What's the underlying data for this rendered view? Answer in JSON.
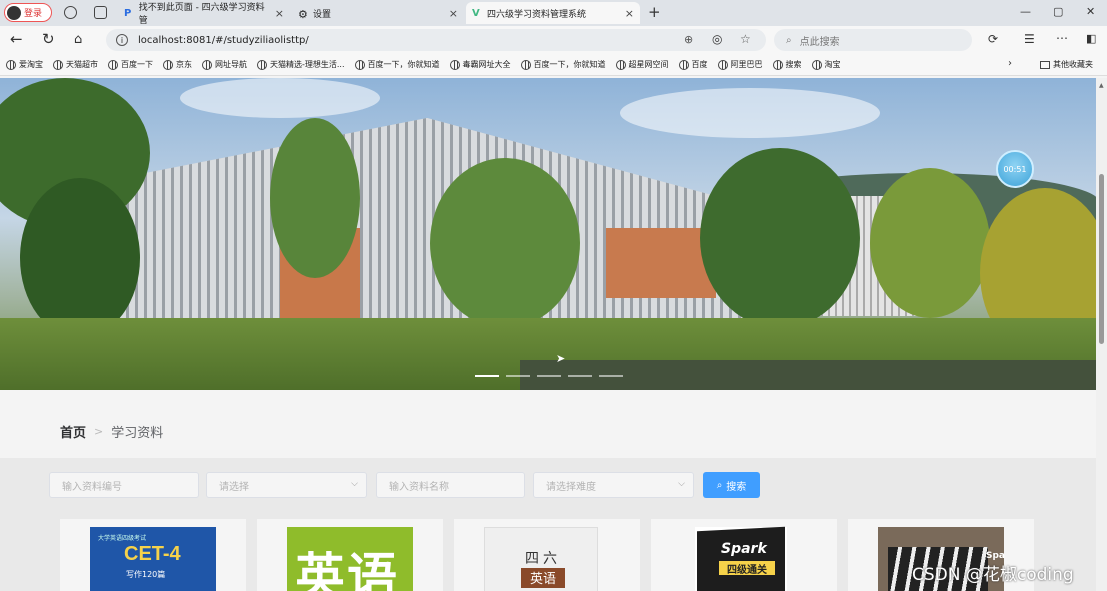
{
  "browser": {
    "profile_label": "登录",
    "tabs": [
      {
        "label": "找不到此页面 - 四六级学习资料管",
        "close": "×"
      },
      {
        "label": "设置",
        "close": "×"
      },
      {
        "label": "四六级学习资料管理系统",
        "close": "×"
      }
    ],
    "new_tab": "+",
    "url": "localhost:8081/#/studyziliaolisttp/",
    "search_placeholder": "点此搜索",
    "bookmarks": [
      "爱淘宝",
      "天猫超市",
      "百度一下",
      "京东",
      "网址导航",
      "天猫精选-理想生活...",
      "百度一下，你就知道",
      "毒霸网址大全",
      "百度一下，你就知道",
      "超星网空间",
      "百度",
      "阿里巴巴",
      "搜索",
      "淘宝"
    ],
    "bookmarks_more": "其他收藏夹"
  },
  "banner": {
    "timer": "00:51",
    "slide_count": 5,
    "active_slide": 0
  },
  "breadcrumb": {
    "home": "首页",
    "current": "学习资料"
  },
  "filter": {
    "code_placeholder": "输入资料编号",
    "select_placeholder": "请选择",
    "name_placeholder": "输入资料名称",
    "difficulty_placeholder": "请选择难度",
    "search_label": "搜索"
  },
  "cards": [
    {
      "title": "CET-4",
      "subtitle": "大学英语四级考试",
      "note": "写作120篇"
    },
    {
      "title": "英语"
    },
    {
      "title": "四六",
      "subtitle": "英语"
    },
    {
      "title": "Spark",
      "subtitle": "四级通关"
    },
    {
      "title": "Spa"
    }
  ],
  "watermark": "CSDN @花椒coding"
}
